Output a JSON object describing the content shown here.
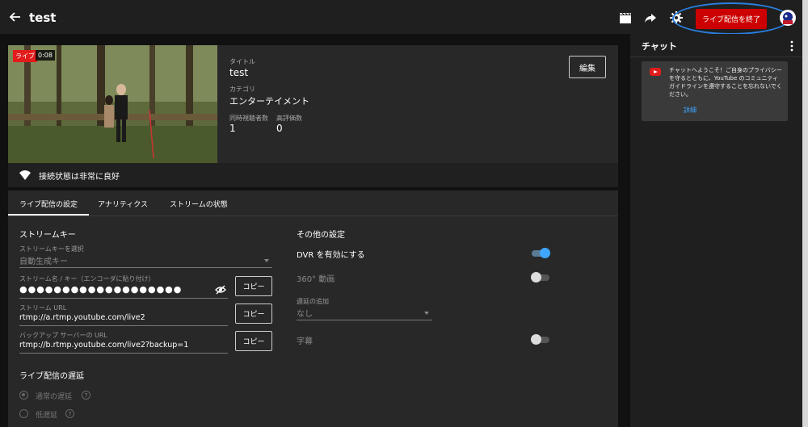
{
  "header": {
    "title": "test",
    "end_button": "ライブ配信を終了",
    "colors": {
      "accent_red": "#cc0000",
      "highlight": "#2a7fe0"
    }
  },
  "preview": {
    "live_badge": "ライブ",
    "elapsed": "0:08",
    "title_label": "タイトル",
    "title_value": "test",
    "category_label": "カテゴリ",
    "category_value": "エンターテイメント",
    "viewers_label": "同時視聴者数",
    "viewers_value": "1",
    "likes_label": "高評価数",
    "likes_value": "0",
    "edit_button": "編集",
    "connection_status": "接続状態は非常に良好"
  },
  "tabs": [
    {
      "label": "ライブ配信の設定",
      "active": true
    },
    {
      "label": "アナリティクス",
      "active": false
    },
    {
      "label": "ストリームの状態",
      "active": false
    }
  ],
  "stream_key": {
    "section_title": "ストリームキー",
    "select_label": "ストリームキーを選択",
    "select_value": "自動生成キー",
    "key_label": "ストリーム名 / キー（エンコーダに貼り付け）",
    "key_value": "●●●●●●●●●●●●●●●●●●●",
    "url_label": "ストリーム URL",
    "url_value": "rtmp://a.rtmp.youtube.com/live2",
    "backup_label": "バックアップ サーバーの URL",
    "backup_value": "rtmp://b.rtmp.youtube.com/live2?backup=1",
    "copy_button": "コピー"
  },
  "latency": {
    "section_title": "ライブ配信の遅延",
    "options": [
      "通常の遅延",
      "低遅延"
    ],
    "help": "?"
  },
  "other_settings": {
    "section_title": "その他の設定",
    "dvr_label": "DVR を有効にする",
    "dvr_enabled": true,
    "video360_label": "360° 動画",
    "video360_enabled": false,
    "delay_label": "遅延の追加",
    "delay_value": "なし",
    "captions_label": "字幕",
    "captions_enabled": false
  },
  "chat": {
    "title": "チャット",
    "welcome_message": "チャットへようこそ！ご自身のプライバシーを守るとともに、YouTube のコミュニティ ガイドラインを遵守することを忘れないでください。",
    "details_link": "詳細"
  }
}
